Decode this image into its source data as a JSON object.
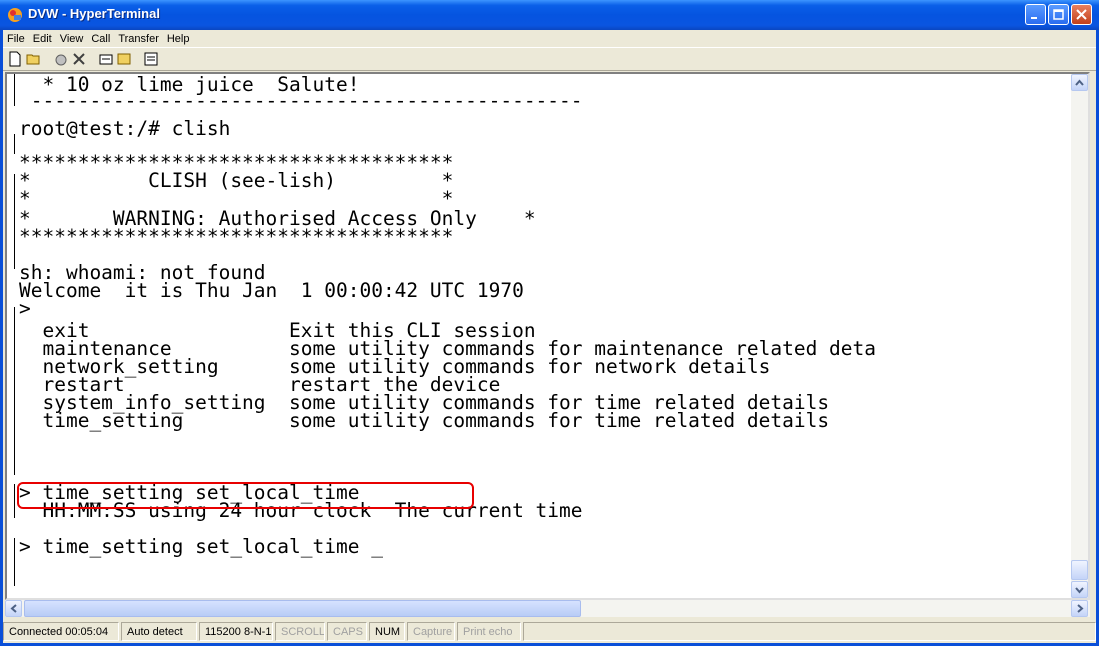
{
  "window": {
    "title": "DVW - HyperTerminal"
  },
  "menu": [
    "File",
    "Edit",
    "View",
    "Call",
    "Transfer",
    "Help"
  ],
  "toolbar_icons": [
    "new-icon",
    "open-icon",
    "connect-icon",
    "disconnect-icon",
    "send-icon",
    "receive-icon",
    "properties-icon"
  ],
  "terminal": {
    "lines": [
      "  * 10 oz lime juice  Salute!",
      " -----------------------------------------------",
      "root@test:/# clish",
      "",
      "*************************************",
      "*          CLISH (see-lish)         *",
      "*                                   *",
      "*       WARNING: Authorised Access Only    *",
      "*************************************",
      "",
      "sh: whoami: not found",
      "Welcome  it is Thu Jan  1 00:00:42 UTC 1970",
      ">",
      "  exit                 Exit this CLI session",
      "  maintenance          some utility commands for maintenance related deta",
      "  network_setting      some utility commands for network details",
      "  restart              restart the device",
      "  system_info_setting  some utility commands for time related details",
      "  time_setting         some utility commands for time related details",
      "",
      "> time_setting set_local_time",
      "  HH:MM:SS using 24 hour clock  The current time",
      "",
      "> time_setting set_local_time _"
    ]
  },
  "status": {
    "connected": "Connected 00:05:04",
    "detect": "Auto detect",
    "settings": "115200 8-N-1",
    "scroll": "SCROLL",
    "caps": "CAPS",
    "num": "NUM",
    "capture": "Capture",
    "print_echo": "Print echo"
  },
  "colors": {
    "titlebar": "#0554e0",
    "highlight_box": "#e80000"
  }
}
